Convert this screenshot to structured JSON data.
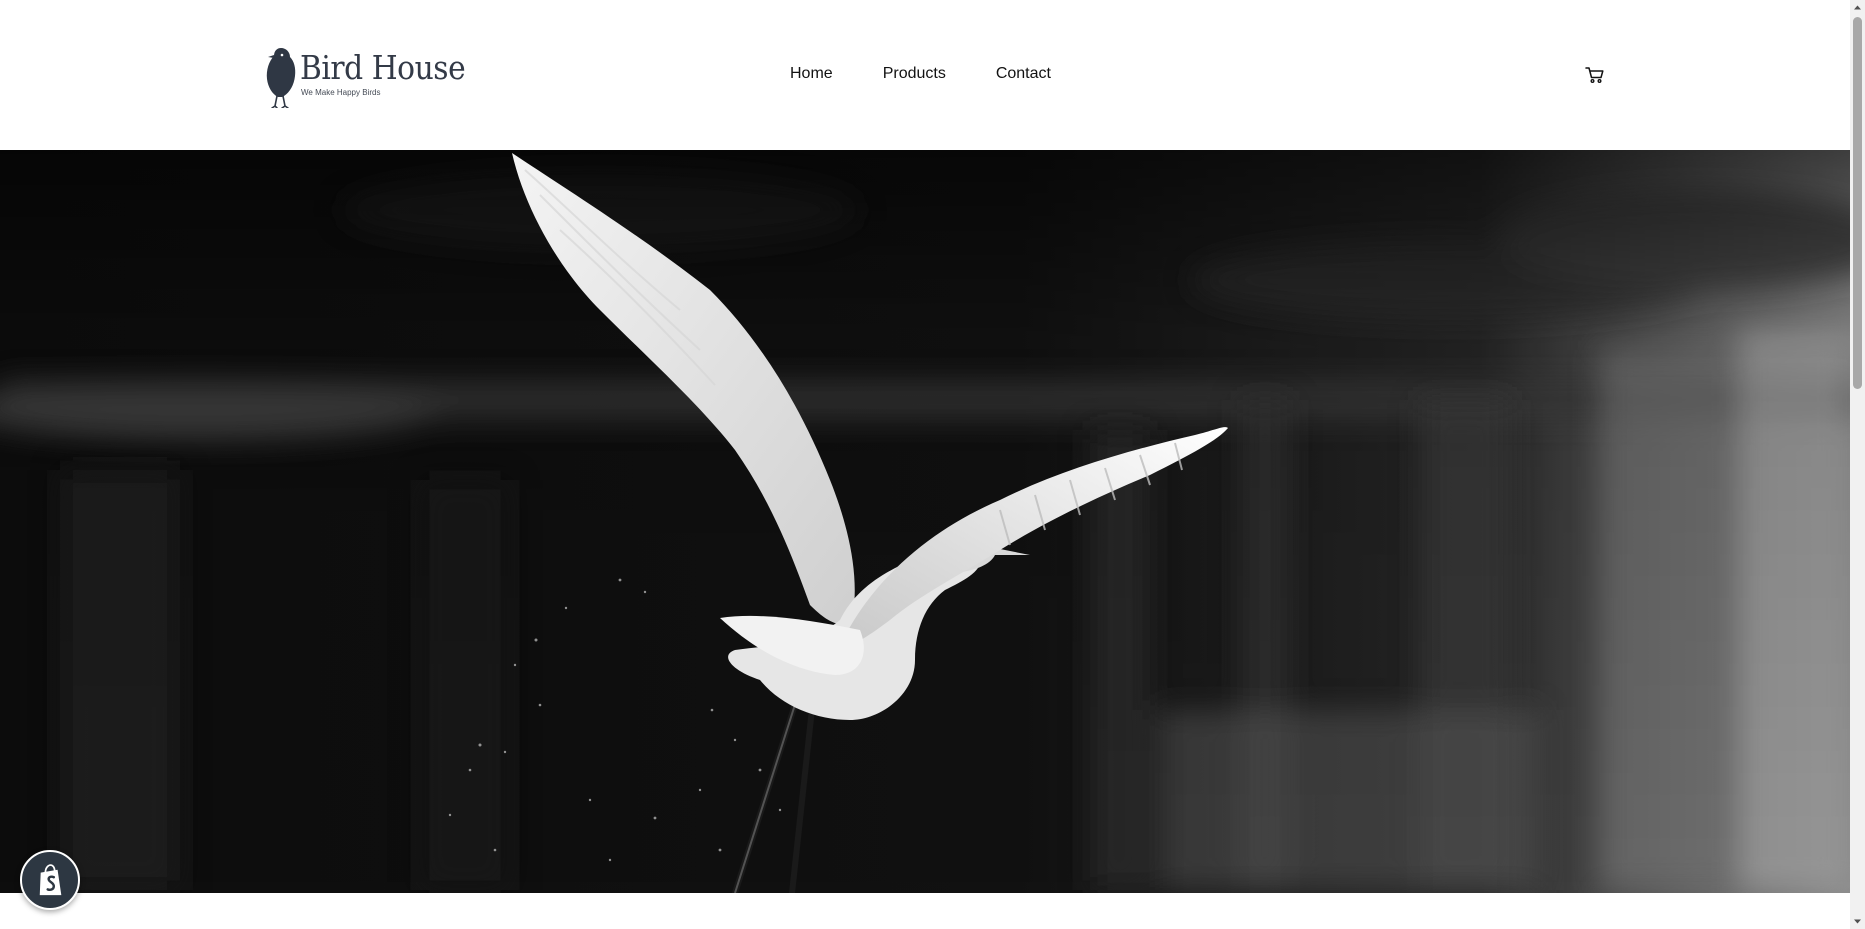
{
  "brand": {
    "name": "Bird House",
    "tagline": "We Make Happy Birds"
  },
  "nav": {
    "items": [
      {
        "label": "Home"
      },
      {
        "label": "Products"
      },
      {
        "label": "Contact"
      }
    ]
  },
  "header": {
    "cart_icon": "cart-icon"
  },
  "hero": {
    "image": "heron-flying-over-water-grayscale"
  },
  "badge": {
    "icon": "shopify-bag-icon",
    "color": "#2d3742"
  },
  "scrollbar": {
    "up_icon": "arrow-up-icon",
    "down_icon": "arrow-down-icon"
  }
}
